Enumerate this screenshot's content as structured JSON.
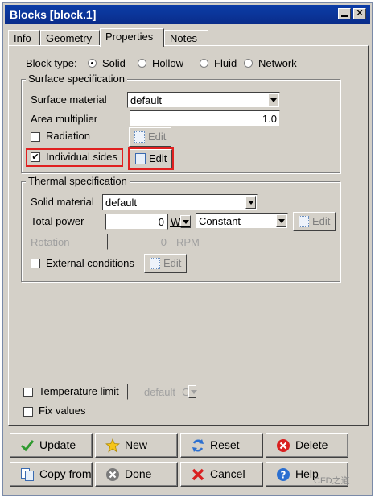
{
  "window": {
    "title": "Blocks [block.1]"
  },
  "tabs": [
    {
      "label": "Info"
    },
    {
      "label": "Geometry"
    },
    {
      "label": "Properties"
    },
    {
      "label": "Notes"
    }
  ],
  "block_type": {
    "label": "Block type:",
    "options": [
      "Solid",
      "Hollow",
      "Fluid",
      "Network"
    ],
    "selected": "Solid"
  },
  "surface": {
    "title": "Surface specification",
    "material_label": "Surface material",
    "material_value": "default",
    "area_label": "Area multiplier",
    "area_value": "1.0",
    "radiation_label": "Radiation",
    "radiation_checked": false,
    "individual_sides_label": "Individual sides",
    "individual_sides_checked": true,
    "check_mark": "✔",
    "edit_label": "Edit"
  },
  "thermal": {
    "title": "Thermal specification",
    "solid_label": "Solid material",
    "solid_value": "default",
    "power_label": "Total power",
    "power_value": "0",
    "power_unit": "W",
    "power_mode": "Constant",
    "rotation_label": "Rotation",
    "rotation_value": "0",
    "rotation_unit": "RPM",
    "external_label": "External conditions",
    "edit_label": "Edit"
  },
  "temperature": {
    "limit_label": "Temperature limit",
    "limit_value": "default",
    "limit_unit": "C",
    "fix_label": "Fix values"
  },
  "buttons": {
    "update": "Update",
    "new": "New",
    "reset": "Reset",
    "delete": "Delete",
    "copy_from": "Copy from",
    "done": "Done",
    "cancel": "Cancel",
    "help": "Help"
  },
  "watermark": "CFD之道",
  "colors": {
    "titlebar": "#0a2c8a",
    "highlight_box": "#e02020",
    "dialog_bg": "#d4d0c8"
  }
}
